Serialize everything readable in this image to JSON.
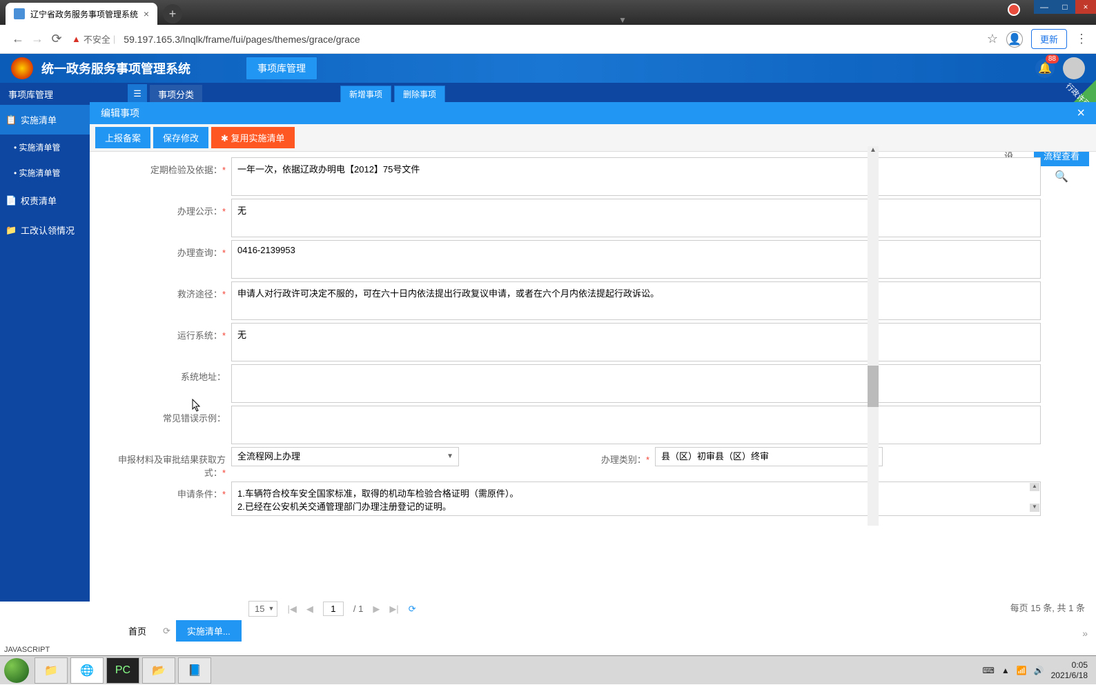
{
  "browser": {
    "tab_title": "辽宁省政务服务事项管理系统",
    "insecure_label": "不安全",
    "url": "59.197.165.3/lnqlk/frame/fui/pages/themes/grace/grace",
    "update_label": "更新"
  },
  "header": {
    "app_title": "统一政务服务事项管理系统",
    "main_btn": "事项库管理",
    "notif_count": "88"
  },
  "secondary": {
    "breadcrumb": "事项库管理",
    "tab1": "事项分类",
    "new_btn": "新增事项",
    "del_btn": "删除事项"
  },
  "sidebar": {
    "items": [
      {
        "label": "实施清单"
      },
      {
        "label": "实施清单管"
      },
      {
        "label": "实施清单管"
      },
      {
        "label": "权责清单"
      },
      {
        "label": "工改认领情况"
      }
    ]
  },
  "modal": {
    "title": "编辑事项",
    "toolbar": {
      "submit": "上报备案",
      "save": "保存修改",
      "reuse": "✱ 复用实施清单"
    }
  },
  "form": {
    "fields": {
      "periodic_check": {
        "label": "定期检验及依据：",
        "value": "一年一次，依据辽政办明电【2012】75号文件"
      },
      "publicity": {
        "label": "办理公示：",
        "value": "无"
      },
      "inquiry": {
        "label": "办理查询：",
        "value": "0416-2139953"
      },
      "remedy": {
        "label": "救济途径：",
        "value": "申请人对行政许可决定不服的，可在六十日内依法提出行政复议申请，或者在六个月内依法提起行政诉讼。"
      },
      "system": {
        "label": "运行系统：",
        "value": "无"
      },
      "sys_addr": {
        "label": "系统地址：",
        "value": ""
      },
      "error_example": {
        "label": "常见错误示例：",
        "value": ""
      },
      "apply_method": {
        "label": "申报材料及审批结果获取方式：",
        "value": "全流程网上办理"
      },
      "handle_type": {
        "label": "办理类别：",
        "value": "县（区）初审县（区）终审"
      },
      "apply_condition": {
        "label": "申请条件：",
        "value": "1.车辆符合校车安全国家标准，取得的机动车检验合格证明（需原件）。\n2.已经在公安机关交通管理部门办理注册登记的证明。"
      }
    }
  },
  "right": {
    "search": "搜索",
    "col1": "设",
    "flow": "流程查看"
  },
  "pagination": {
    "page_size": "15",
    "current": "1",
    "total_pages": "/ 1",
    "info": "每页 15 条, 共 1 条"
  },
  "bottom_tabs": {
    "home": "首页",
    "active": "实施清单..."
  },
  "taskbar": {
    "time": "0:05",
    "date": "2021/6/18"
  },
  "status": "JAVASCRIPT"
}
